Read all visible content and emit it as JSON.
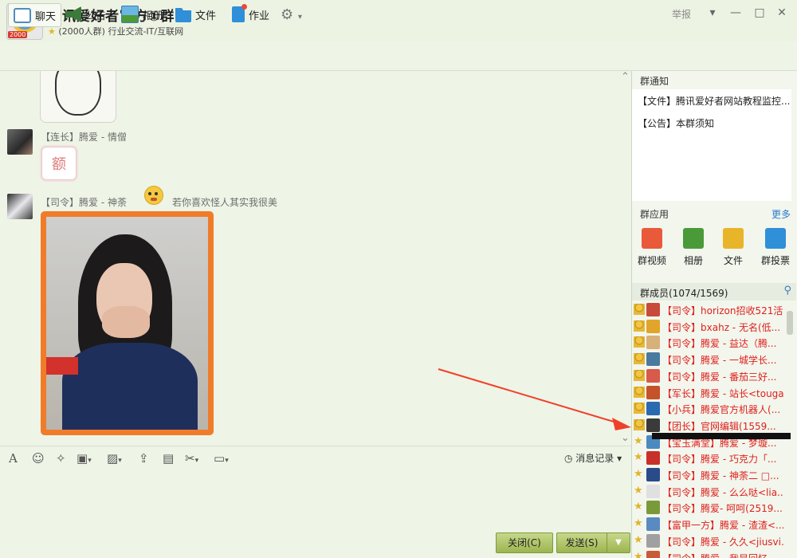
{
  "window": {
    "title": "腾讯爱好者官方①群",
    "subtitle": "(2000人群) 行业交流-IT/互联网",
    "logo_badge": "2000",
    "report": "举报",
    "controls": [
      "—",
      "□",
      "✕"
    ]
  },
  "toolbar": {
    "tabs": [
      {
        "label": "聊天",
        "icon": "chat-icon"
      },
      {
        "label": "公告",
        "icon": "announcement-icon"
      },
      {
        "label": "相册",
        "icon": "album-icon"
      },
      {
        "label": "文件",
        "icon": "folder-icon"
      },
      {
        "label": "作业",
        "icon": "homework-icon"
      }
    ],
    "more_icon": "gear-icon"
  },
  "chat": {
    "messages": [
      {
        "header": "【连长】腾爱 - 情僧",
        "content": "额"
      },
      {
        "header": "【司令】腾爱 - 神荼",
        "header2": "若你喜欢怪人其实我很美"
      }
    ]
  },
  "input": {
    "history": "消息记录",
    "close_label": "关闭(C)",
    "send_label": "发送(S)"
  },
  "sidebar": {
    "notice_title": "群通知",
    "notices": [
      "【文件】腾讯爱好者网站教程监控...",
      "【公告】本群须知"
    ],
    "apps_title": "群应用",
    "more": "更多",
    "apps": [
      {
        "label": "群视频",
        "color": "#e85a3a"
      },
      {
        "label": "相册",
        "color": "#4a9a3a"
      },
      {
        "label": "文件",
        "color": "#e8b42a"
      },
      {
        "label": "群投票",
        "color": "#2f8fd8"
      }
    ],
    "members_title": "群成员(1074/1569)",
    "members": [
      {
        "role": "【司令】",
        "name": "horizon招收521活..."
      },
      {
        "role": "【司令】",
        "name": "bxahz - 无名(低..."
      },
      {
        "role": "【司令】",
        "name": "腾爱 - 益达（腾..."
      },
      {
        "role": "【司令】",
        "name": "腾爱 - 一城学长..."
      },
      {
        "role": "【司令】",
        "name": "腾爱 - 番茄三好..."
      },
      {
        "role": "【军长】",
        "name": "腾爱 - 站长<touga..."
      },
      {
        "role": "【小兵】",
        "name": "腾爱官方机器人(..."
      },
      {
        "role": "【团长】",
        "name": "官网编辑(1559..."
      },
      {
        "role": "【宝玉满堂】",
        "name": "腾爱 - 梦璇..."
      },
      {
        "role": "【司令】",
        "name": "腾爱 - 巧克力「..."
      },
      {
        "role": "【司令】",
        "name": "腾爱 - 神荼二 □..."
      },
      {
        "role": "【司令】",
        "name": "腾爱 - 么么哒<lia..."
      },
      {
        "role": "【司令】",
        "name": "腾爱- 呵呵(2519..."
      },
      {
        "role": "【富甲一方】",
        "name": "腾爱 - 渣渣<..."
      },
      {
        "role": "【司令】",
        "name": "腾爱 - 久久<jiusvi..."
      },
      {
        "role": "【司令】",
        "name": "腾爱 - 我是回忆..."
      }
    ]
  }
}
